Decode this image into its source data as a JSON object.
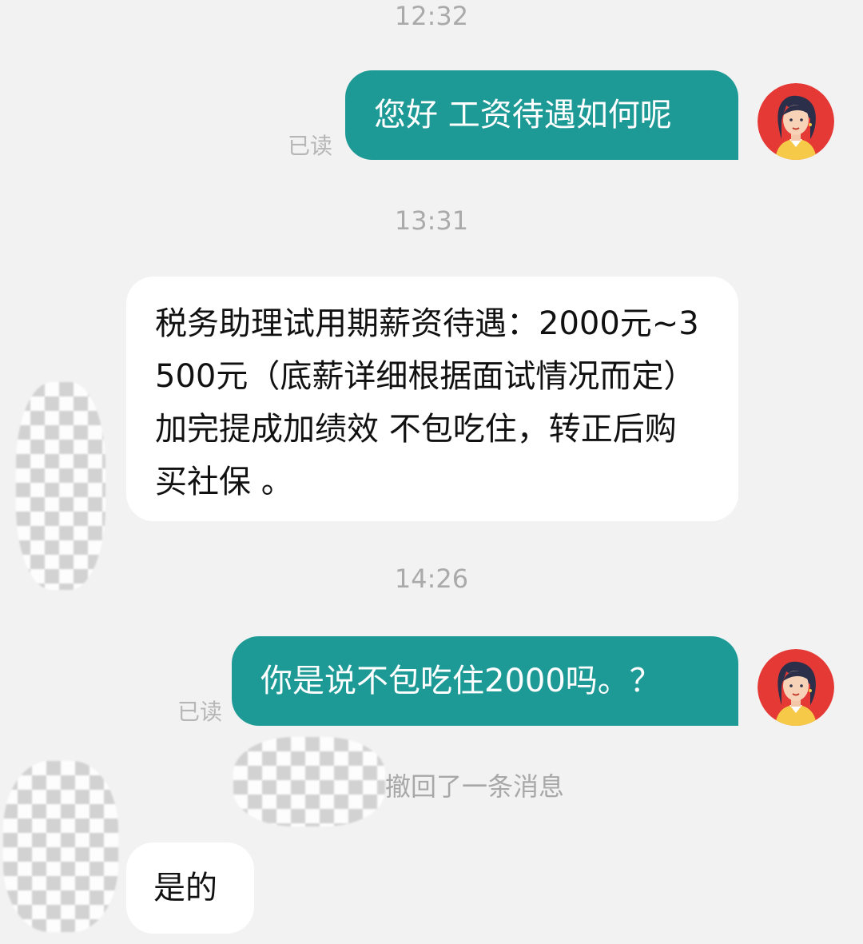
{
  "messages": {
    "time_1": "12:32",
    "time_2": "13:31",
    "time_3": "14:26",
    "msg_1": "您好 工资待遇如何呢",
    "msg_1_status": "已读",
    "msg_2": "税务助理试用期薪资待遇：2000元~3500元（底薪详细根据面试情况而定）加完提成加绩效  不包吃住，转正后购买社保 。",
    "msg_3": "你是说不包吃住2000吗。？",
    "msg_3_status": "已读",
    "recall_notice": "撤回了一条消息",
    "msg_4": "是的"
  },
  "colors": {
    "background": "#f2f2f2",
    "my_bubble": "#1e9a96",
    "their_bubble": "#ffffff",
    "avatar_bg": "#e53935"
  },
  "icons": {
    "my_avatar": "woman-avatar-icon"
  }
}
